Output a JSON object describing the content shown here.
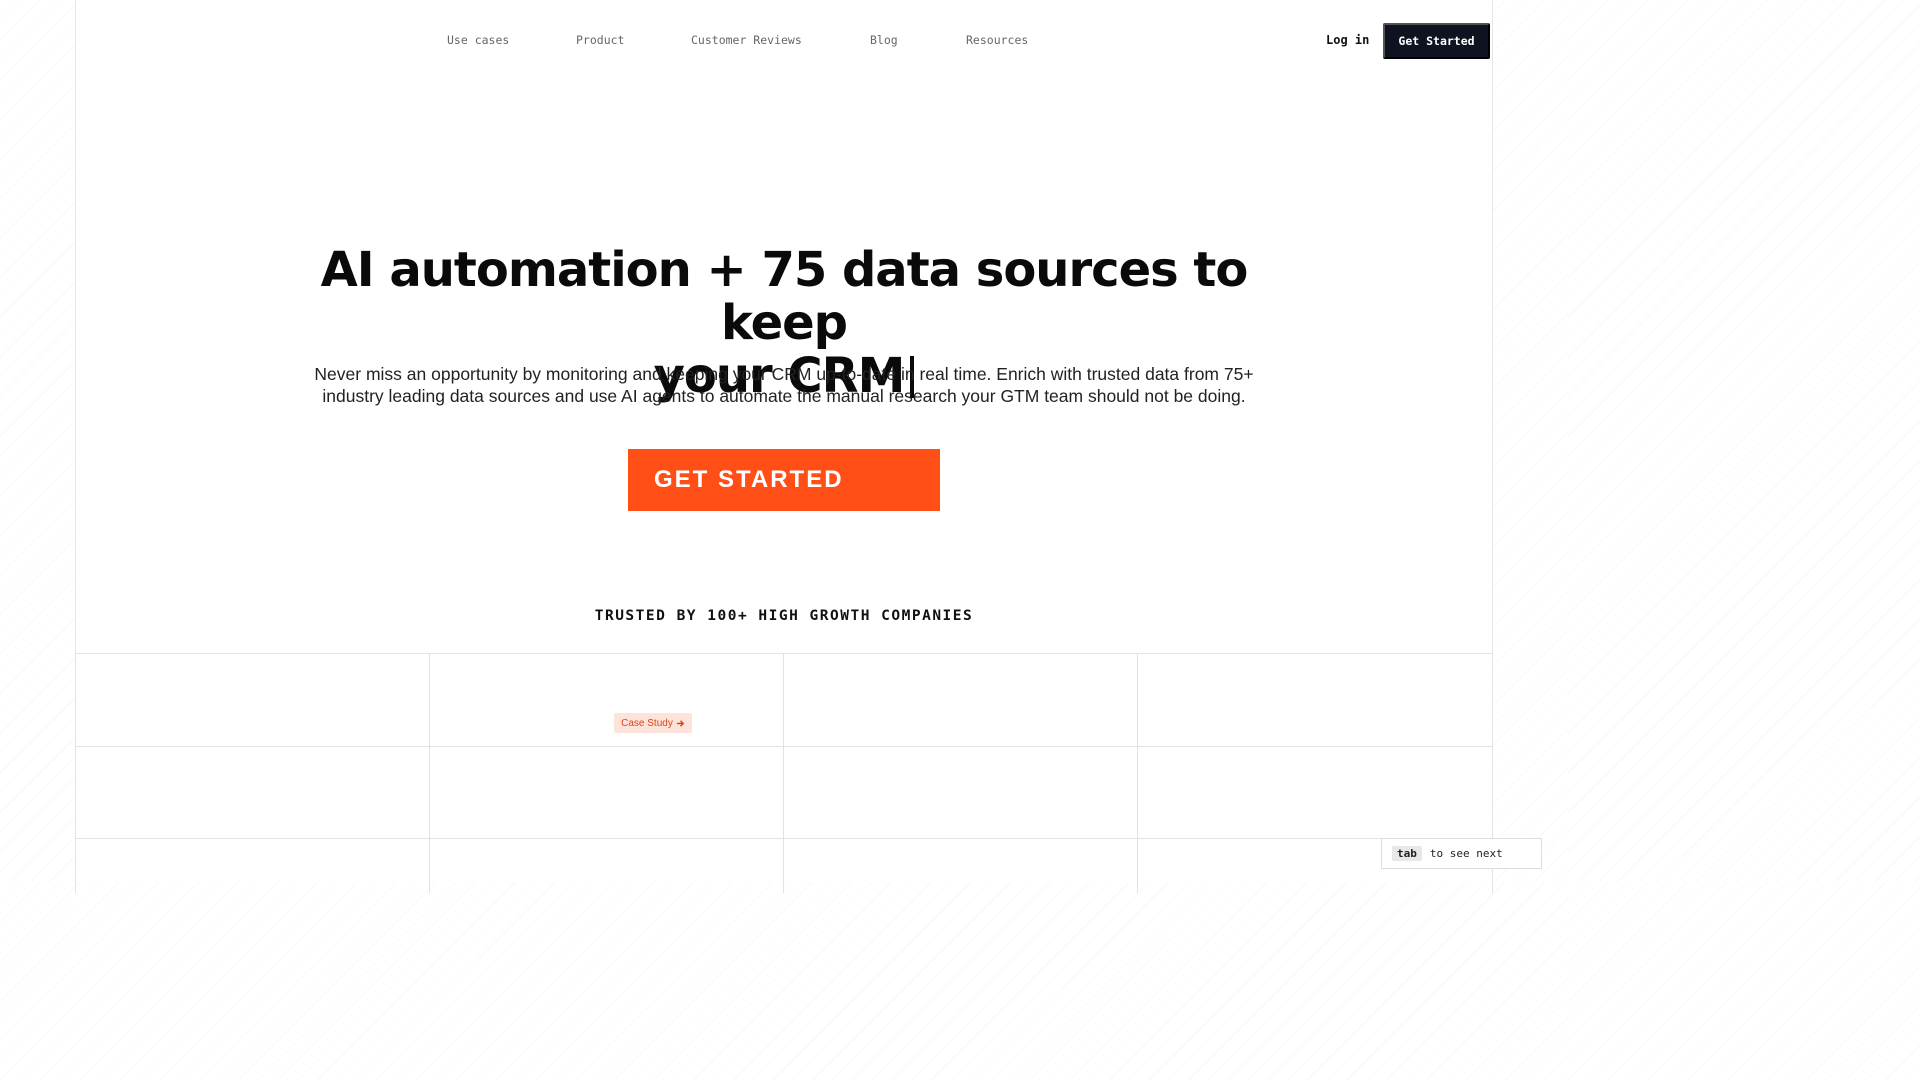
{
  "nav": {
    "links": [
      "Use cases",
      "Product",
      "Customer Reviews",
      "Blog",
      "Resources"
    ],
    "login_label": "Log in",
    "get_started_label": "Get Started"
  },
  "hero": {
    "headline_line1": "AI automation + 75 data sources to keep",
    "headline_line2": "your CRM",
    "subtext_line1": "Never miss an opportunity by monitoring and keeping your CRM up-to-date in real time. Enrich with trusted data from 75+",
    "subtext_line2": "industry leading data sources and use AI agents to automate the manual research your GTM team should not be doing.",
    "cta_label": "GET STARTED"
  },
  "trusted": {
    "heading": "TRUSTED BY 100+ HIGH GROWTH COMPANIES",
    "case_study_label": "Case Study"
  },
  "hint": {
    "key": "tab",
    "text": "to see next"
  },
  "colors": {
    "accent": "#ff4f17",
    "dark": "#0f1220",
    "badge_bg": "#fde3da"
  }
}
